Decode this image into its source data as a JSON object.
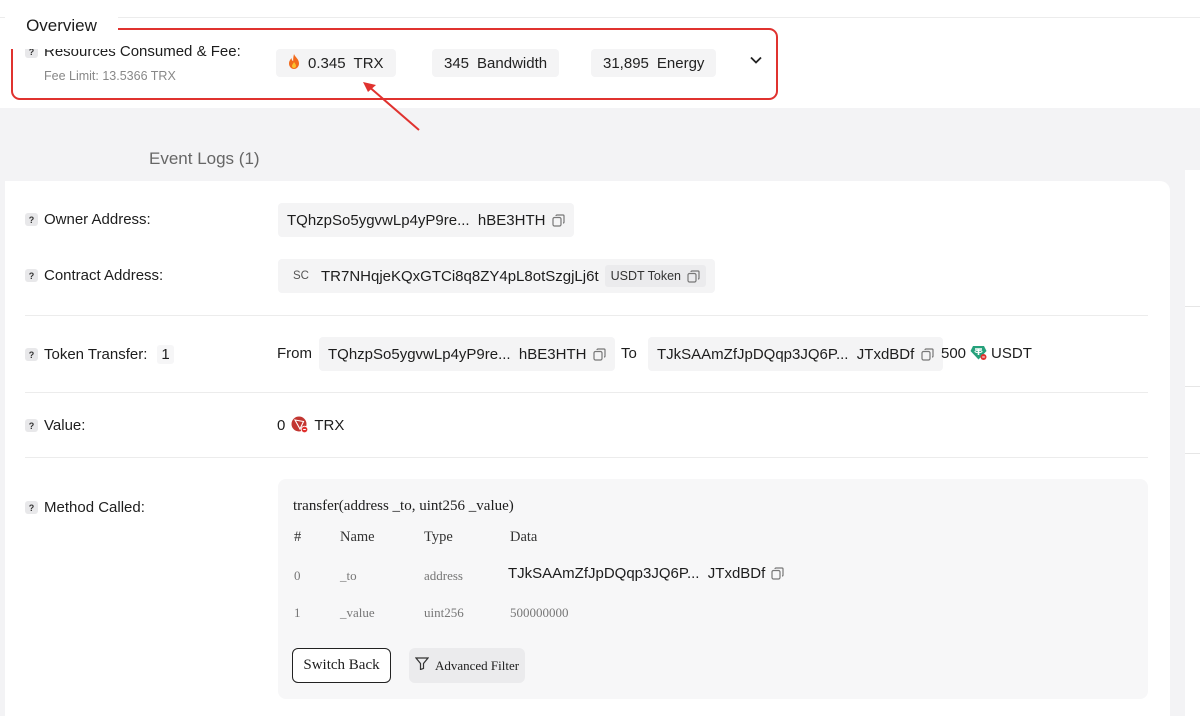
{
  "resources": {
    "label": "Resources Consumed & Fee:",
    "fee_limit": "Fee Limit: 13.5366 TRX",
    "trx_amount": "0.345",
    "trx_unit": "TRX",
    "bandwidth_amount": "345",
    "bandwidth_unit": "Bandwidth",
    "energy_amount": "31,895",
    "energy_unit": "Energy"
  },
  "tabs": [
    {
      "label": "Overview",
      "active": true
    },
    {
      "label": "Event Logs (1)",
      "active": false
    }
  ],
  "overview": {
    "owner": {
      "label": "Owner Address:",
      "address": "TQhzpSo5ygvwLp4yP9re...  hBE3HTH"
    },
    "contract": {
      "label": "Contract Address:",
      "tag": "SC",
      "address": "TR7NHqjeKQxGTCi8q8ZY4pL8otSzgjLj6t",
      "token_tag": "USDT Token"
    },
    "token_transfer": {
      "label": "Token Transfer:",
      "count": "1",
      "from_label": "From",
      "from_address": "TQhzpSo5ygvwLp4yP9re...  hBE3HTH",
      "to_label": "To",
      "to_address": "TJkSAAmZfJpDQqp3JQ6P...  JTxdBDf",
      "amount": "500",
      "token": "USDT"
    },
    "value": {
      "label": "Value:",
      "amount": "0",
      "unit": "TRX"
    },
    "method": {
      "label": "Method Called:",
      "signature": "transfer(address _to, uint256 _value)",
      "headers": [
        "#",
        "Name",
        "Type",
        "Data"
      ],
      "rows": [
        {
          "index": "0",
          "name": "_to",
          "type": "address",
          "data": "TJkSAAmZfJpDQqp3JQ6P...  JTxdBDf"
        },
        {
          "index": "1",
          "name": "_value",
          "type": "uint256",
          "data": "500000000"
        }
      ],
      "switch_back": "Switch Back",
      "advanced_filter": "Advanced Filter"
    }
  },
  "colors": {
    "highlight": "#e0322f",
    "flame": "#f26b1d",
    "trx_red": "#c23631",
    "usdt_green": "#26a17b"
  }
}
